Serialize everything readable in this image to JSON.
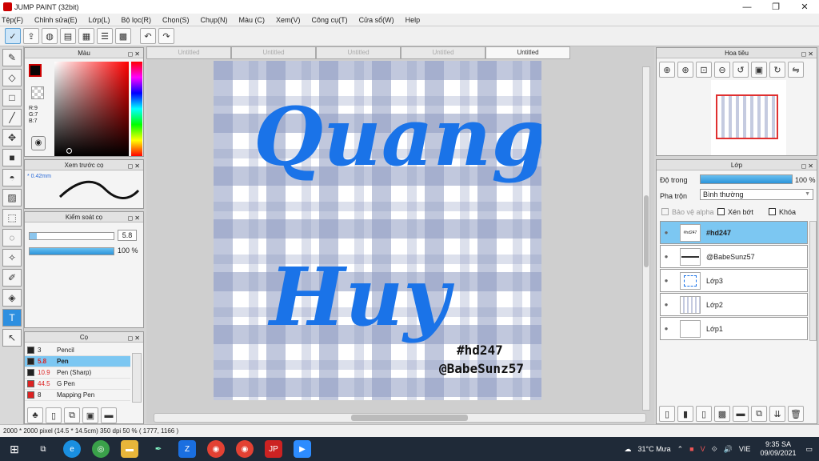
{
  "window": {
    "title": "JUMP PAINT (32bit)",
    "btn_min": "—",
    "btn_max": "❐",
    "btn_close": "✕"
  },
  "menu": [
    "Tệp(F)",
    "Chỉnh sửa(E)",
    "Lớp(L)",
    "Bộ lọc(R)",
    "Chọn(S)",
    "Chụp(N)",
    "Màu (C)",
    "Xem(V)",
    "Công cụ(T)",
    "Cửa sổ(W)",
    "Help"
  ],
  "tabs": [
    "Untitled",
    "Untitled",
    "Untitled",
    "Untitled",
    "Untitled"
  ],
  "color_panel": {
    "title": "Màu",
    "r": "R:9",
    "g": "G:7",
    "b": "B:7"
  },
  "brush_preview": {
    "title": "Xem trước cọ",
    "size": "* 0.42mm"
  },
  "brush_control": {
    "title": "Kiểm soát cọ",
    "size_value": "5.8",
    "opacity_value": "100 %"
  },
  "brush_list": {
    "title": "Cọ",
    "items": [
      {
        "size": "3",
        "name": "Pencil"
      },
      {
        "size": "5.8",
        "name": "Pen"
      },
      {
        "size": "10.9",
        "name": "Pen (Sharp)"
      },
      {
        "size": "44.5",
        "name": "G Pen"
      },
      {
        "size": "8",
        "name": "Mapping Pen"
      }
    ]
  },
  "artwork": {
    "line1": "Quang",
    "line2": "Huy",
    "tag1": "#hd247",
    "tag2": "@BabeSunz57"
  },
  "navigator": {
    "title": "Hoa tiêu"
  },
  "layers": {
    "title": "Lớp",
    "opacity_label": "Độ trong",
    "opacity_value": "100 %",
    "blend_label": "Pha trộn",
    "blend_value": "Bình thường",
    "protect_alpha": "Bảo vệ alpha",
    "clipping": "Xén bớt",
    "lock": "Khóa",
    "items": [
      {
        "name": "#hd247",
        "thumb": "#hd247"
      },
      {
        "name": "@BabeSunz57",
        "thumb": ""
      },
      {
        "name": "Lớp3",
        "thumb": ""
      },
      {
        "name": "Lớp2",
        "thumb": ""
      },
      {
        "name": "Lớp1",
        "thumb": ""
      }
    ]
  },
  "status": {
    "text": "2000 * 2000 pixel   (14.5 * 14.5cm)   350 dpi   50 %   ( 1777, 1166 )"
  },
  "taskbar": {
    "weather": "31°C  Mưa",
    "lang": "VIE",
    "time": "9:35 SA",
    "date": "09/09/2021"
  },
  "colors": {
    "accent": "#1a73e8",
    "gingham": "#8d9ac0",
    "selected_layer": "#7cc7f2"
  }
}
